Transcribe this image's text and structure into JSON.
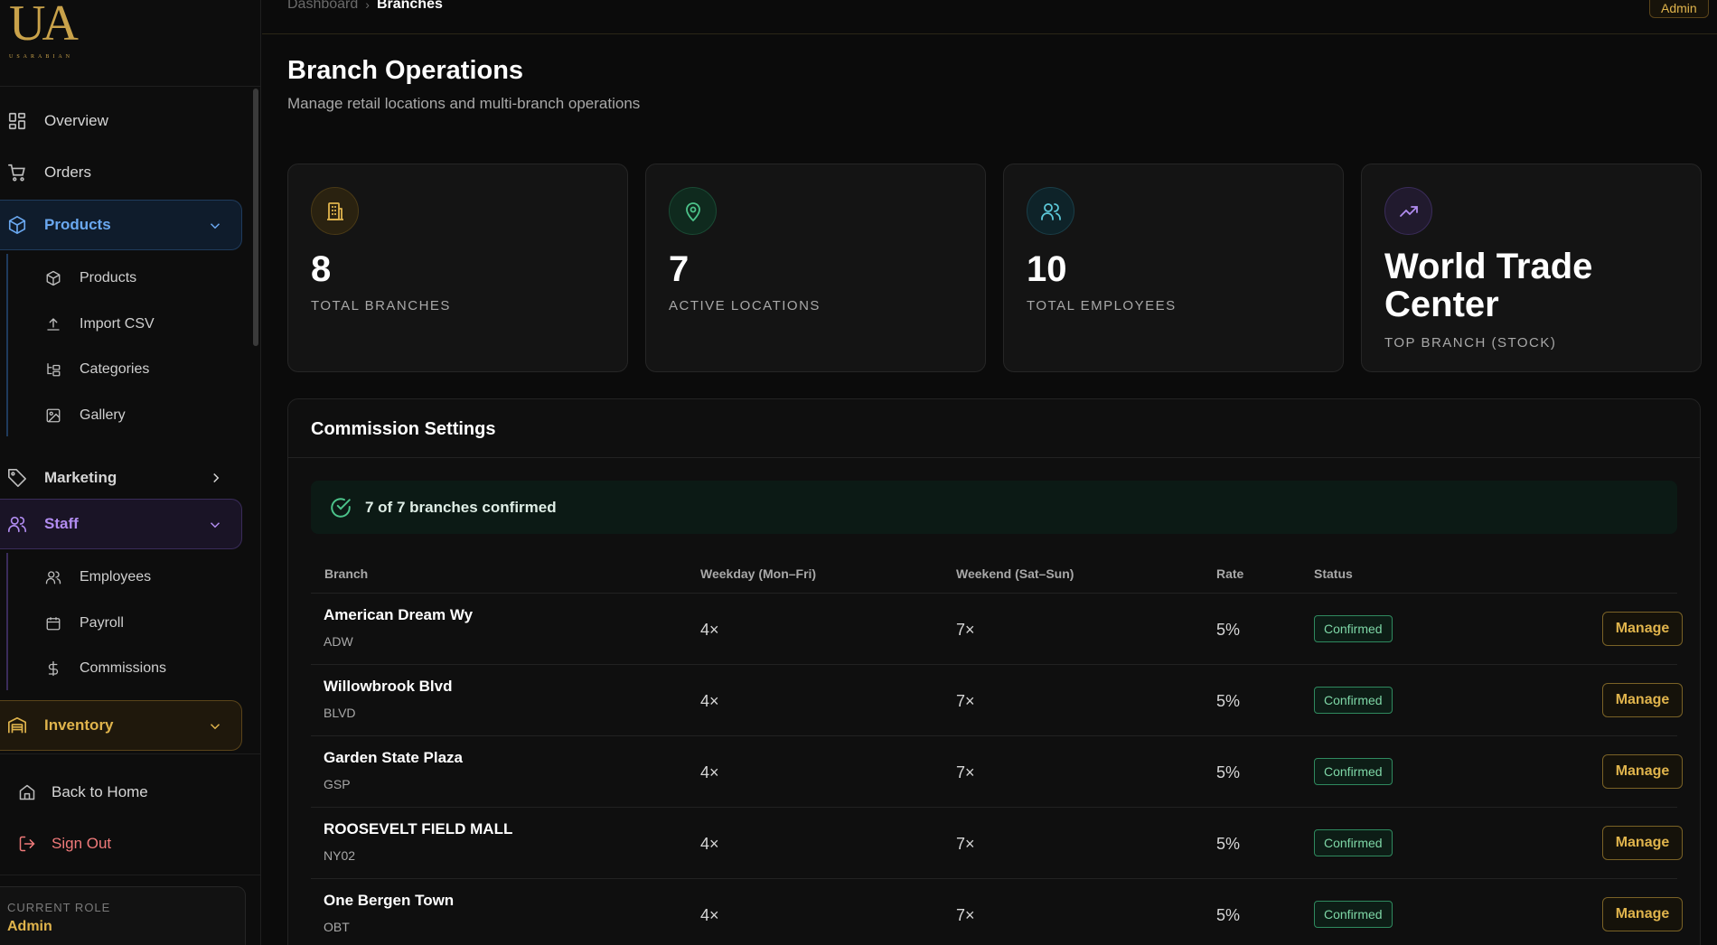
{
  "brand": {
    "logo_text": "UA",
    "logo_subtext": "USARABIAN"
  },
  "sidebar": {
    "overview": "Overview",
    "orders": "Orders",
    "products_group": "Products",
    "products_items": [
      "Products",
      "Import CSV",
      "Categories",
      "Gallery"
    ],
    "marketing": "Marketing",
    "staff_group": "Staff",
    "staff_items": [
      "Employees",
      "Payroll",
      "Commissions"
    ],
    "inventory_group": "Inventory",
    "back_home": "Back to Home",
    "sign_out": "Sign Out",
    "role_label": "CURRENT ROLE",
    "role_value": "Admin"
  },
  "topbar": {
    "breadcrumb_parent": "Dashboard",
    "breadcrumb_current": "Branches",
    "admin_badge": "Admin"
  },
  "header": {
    "title": "Branch Operations",
    "subtitle": "Manage retail locations and multi-branch operations"
  },
  "stats": [
    {
      "value": "8",
      "label": "TOTAL BRANCHES",
      "icon": "building-icon",
      "color": "#e0b44c"
    },
    {
      "value": "7",
      "label": "ACTIVE LOCATIONS",
      "icon": "map-pin-icon",
      "color": "#4cc38a"
    },
    {
      "value": "10",
      "label": "TOTAL EMPLOYEES",
      "icon": "users-icon",
      "color": "#5cc8d8"
    },
    {
      "value": "World Trade Center",
      "label": "TOP BRANCH (STOCK)",
      "icon": "trending-up-icon",
      "color": "#b18cf0"
    }
  ],
  "commission": {
    "title": "Commission Settings",
    "confirmed_text": "7 of 7 branches confirmed",
    "columns": [
      "Branch",
      "Weekday (Mon–Fri)",
      "Weekend (Sat–Sun)",
      "Rate",
      "Status"
    ],
    "rows": [
      {
        "name": "American Dream Wy",
        "code": "ADW",
        "weekday": "4×",
        "weekend": "7×",
        "rate": "5%",
        "status": "Confirmed",
        "action": "Manage"
      },
      {
        "name": "Willowbrook Blvd",
        "code": "BLVD",
        "weekday": "4×",
        "weekend": "7×",
        "rate": "5%",
        "status": "Confirmed",
        "action": "Manage"
      },
      {
        "name": "Garden State Plaza",
        "code": "GSP",
        "weekday": "4×",
        "weekend": "7×",
        "rate": "5%",
        "status": "Confirmed",
        "action": "Manage"
      },
      {
        "name": "ROOSEVELT FIELD MALL",
        "code": "NY02",
        "weekday": "4×",
        "weekend": "7×",
        "rate": "5%",
        "status": "Confirmed",
        "action": "Manage"
      },
      {
        "name": "One Bergen Town",
        "code": "OBT",
        "weekday": "4×",
        "weekend": "7×",
        "rate": "5%",
        "status": "Confirmed",
        "action": "Manage"
      }
    ]
  },
  "colors": {
    "accent_gold": "#e0b44c",
    "products_blue": "#6aa8f0",
    "staff_purple": "#b18cf0",
    "success_green": "#4cc38a",
    "danger_red": "#f07a7a"
  }
}
